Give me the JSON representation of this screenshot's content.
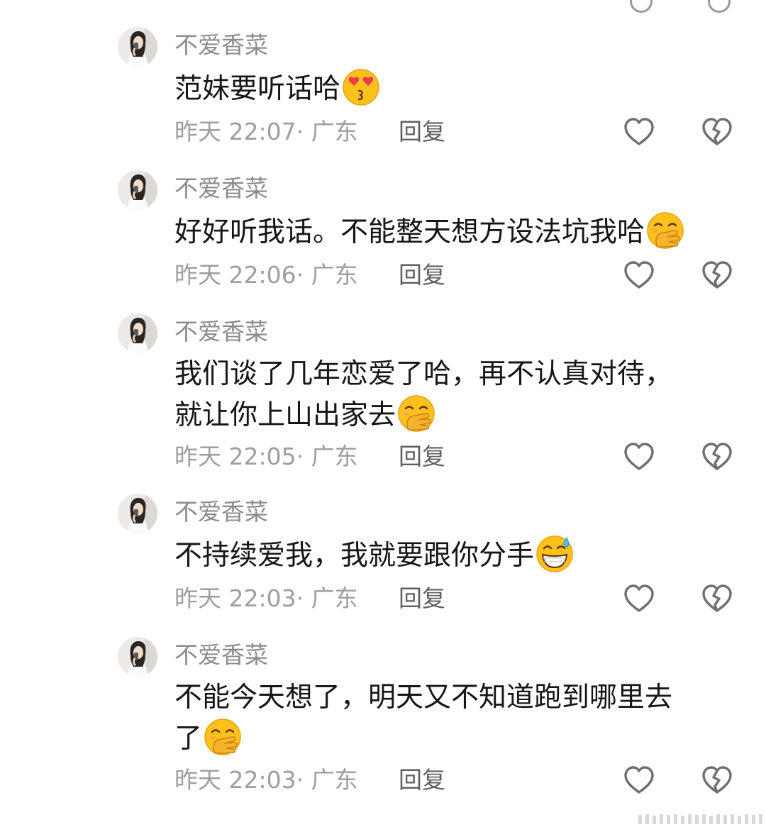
{
  "comments": [
    {
      "username": "不爱香菜",
      "text": "范妹要听话哈",
      "emoji": "heart-eyes-kiss-emoji",
      "time": "昨天 22:07· 广东",
      "reply_label": "回复"
    },
    {
      "username": "不爱香菜",
      "text": "好好听我话。不能整天想方设法坑我哈",
      "emoji": "hand-over-mouth-emoji",
      "time": "昨天 22:06· 广东",
      "reply_label": "回复"
    },
    {
      "username": "不爱香菜",
      "text": "我们谈了几年恋爱了哈，再不认真对待，\n就让你上山出家去",
      "emoji": "hand-over-mouth-emoji",
      "time": "昨天 22:05· 广东",
      "reply_label": "回复"
    },
    {
      "username": "不爱香菜",
      "text": "不持续爱我，我就要跟你分手",
      "emoji": "grinning-sweat-emoji",
      "time": "昨天 22:03· 广东",
      "reply_label": "回复"
    },
    {
      "username": "不爱香菜",
      "text": "不能今天想了，明天又不知道跑到哪里去\n了",
      "emoji": "hand-over-mouth-emoji",
      "time": "昨天 22:03· 广东",
      "reply_label": "回复"
    }
  ],
  "icons": {
    "like": "heart-outline-icon",
    "dislike": "broken-heart-icon"
  },
  "colors": {
    "text": "#161616",
    "username": "#8c8c8c",
    "meta": "#9e9e9e",
    "reply": "#5f5f5f",
    "icon": "#6f6f6f",
    "emoji_face": "#fcc21b"
  }
}
